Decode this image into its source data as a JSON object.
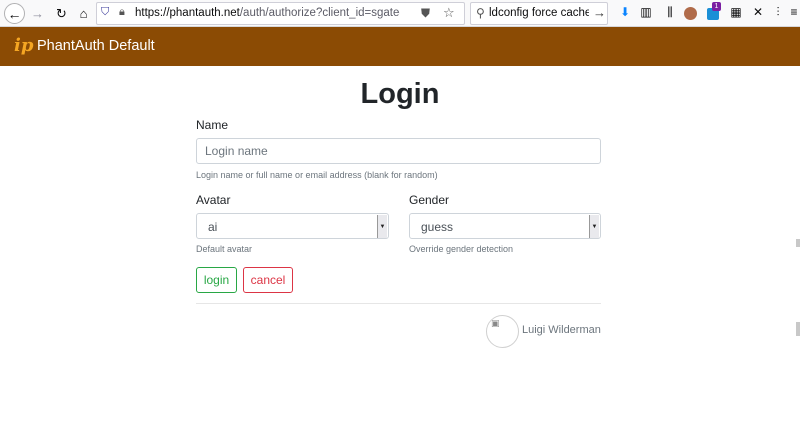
{
  "browser": {
    "url_host": "https://phantauth.net",
    "url_path": "/auth/authorize?client_id=sgate-oidc",
    "search_text": "ldconfig force cache re",
    "ext_badge_count": "1"
  },
  "navbar": {
    "brand_logo": "ip",
    "brand_name": "PhantAuth Default",
    "bg_color": "#8b4b04"
  },
  "form": {
    "title": "Login",
    "name_label": "Name",
    "name_placeholder": "Login name",
    "name_help": "Login name or full name or email address (blank for random)",
    "avatar_label": "Avatar",
    "avatar_value": "ai",
    "avatar_help": "Default avatar",
    "gender_label": "Gender",
    "gender_value": "guess",
    "gender_help": "Override gender detection",
    "login_label": "login",
    "cancel_label": "cancel"
  },
  "user": {
    "name": "Luigi Wilderman"
  },
  "colors": {
    "success": "#28a745",
    "danger": "#dc3545"
  }
}
